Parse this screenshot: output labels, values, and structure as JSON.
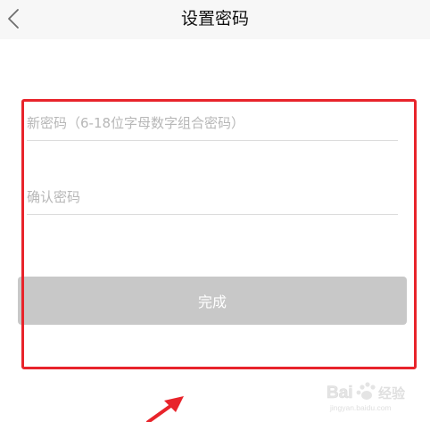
{
  "navbar": {
    "title": "设置密码",
    "back_icon": "chevron-left-icon"
  },
  "form": {
    "new_password": {
      "value": "",
      "placeholder": "新密码（6-18位字母数字组合密码）"
    },
    "confirm_password": {
      "value": "",
      "placeholder": "确认密码"
    },
    "submit_label": "完成"
  },
  "annotation": {
    "highlight_color": "#e8242b",
    "arrow_color": "#e8242b"
  },
  "watermark": {
    "text": "Bai 经验",
    "subtext": "jingyan.baidu.com"
  },
  "colors": {
    "button_disabled": "#c8c8c8",
    "navbar_bg": "#f7f7f7"
  }
}
